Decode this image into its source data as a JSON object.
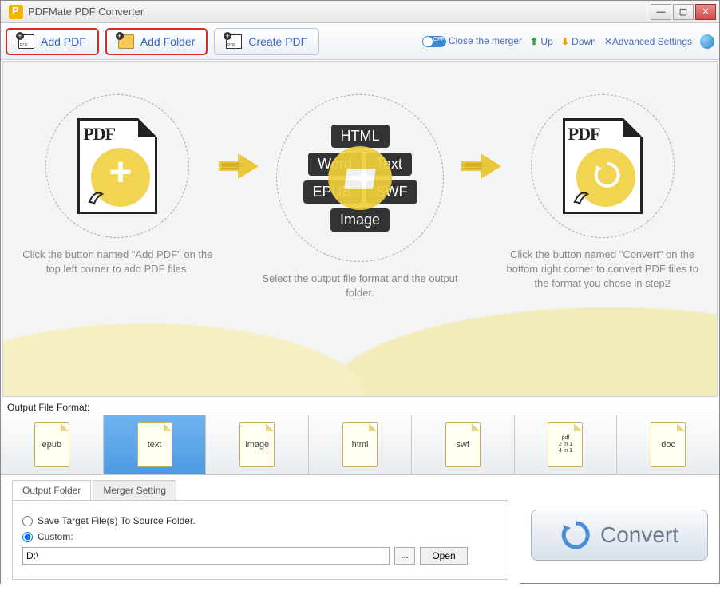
{
  "titlebar": {
    "title": "PDFMate PDF Converter"
  },
  "toolbar": {
    "add_pdf": "Add PDF",
    "add_folder": "Add Folder",
    "create_pdf": "Create PDF",
    "close_merger": "Close the merger",
    "up": "Up",
    "down": "Down",
    "advanced": "Advanced Settings"
  },
  "steps": {
    "s1": "Click the button named \"Add PDF\" on the top left corner to add PDF files.",
    "s2": "Select the output file format and the output folder.",
    "s3": "Click the button named \"Convert\" on the bottom right corner to convert PDF files to the format you chose in step2"
  },
  "format_tags": {
    "html": "HTML",
    "word": "Word",
    "text": "Text",
    "epub": "EPUB",
    "swf": "SWF",
    "image": "Image",
    "pdflbl": "PDF"
  },
  "output_label": "Output File Format:",
  "formats": {
    "epub": "epub",
    "text": "text",
    "image": "image",
    "html": "html",
    "swf": "swf",
    "pdf_top": "pdf",
    "pdf_lines": "2 in 1\n4 in 1",
    "doc": "doc"
  },
  "tabs": {
    "output_folder": "Output Folder",
    "merger_setting": "Merger Setting"
  },
  "radios": {
    "save_source": "Save Target File(s) To Source Folder.",
    "custom": "Custom:"
  },
  "path_value": "D:\\",
  "open_label": "Open",
  "browse_label": "...",
  "convert_label": "Convert"
}
